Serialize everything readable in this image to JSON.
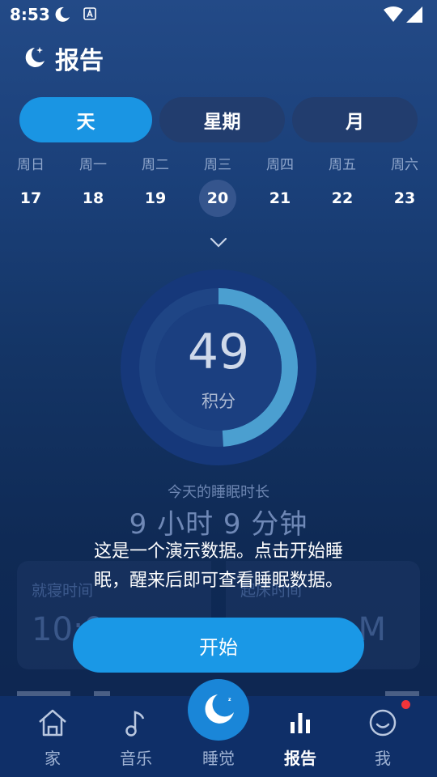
{
  "status_bar": {
    "time": "8:53"
  },
  "header": {
    "title": "报告"
  },
  "tabs": [
    {
      "label": "天",
      "active": true
    },
    {
      "label": "星期",
      "active": false
    },
    {
      "label": "月",
      "active": false
    }
  ],
  "week": {
    "days": [
      "周日",
      "周一",
      "周二",
      "周三",
      "周四",
      "周五",
      "周六"
    ],
    "dates": [
      "17",
      "18",
      "19",
      "20",
      "21",
      "22",
      "23"
    ],
    "selected_date": "20"
  },
  "score": {
    "value": "49",
    "label": "积分",
    "progress_fraction": 0.49
  },
  "duration": {
    "label": "今天的睡眠时长",
    "value": "9 小时 9 分钟"
  },
  "cards": {
    "bedtime_label": "就寝时间",
    "bedtime_value": "10:0",
    "wake_label": "起床时间",
    "wake_value": "M"
  },
  "demo": {
    "message_line1": "这是一个演示数据。点击开始睡",
    "message_line2": "眠，醒来后即可查看睡眠数据。",
    "start_button": "开始"
  },
  "nav": {
    "home": "家",
    "music": "音乐",
    "sleep": "睡觉",
    "report": "报告",
    "me": "我",
    "active": "报告"
  },
  "colors": {
    "accent": "#1a98e6",
    "ring_progress": "#4b9fd0",
    "ring_track": "#1c4080",
    "notification": "#f0343a"
  }
}
